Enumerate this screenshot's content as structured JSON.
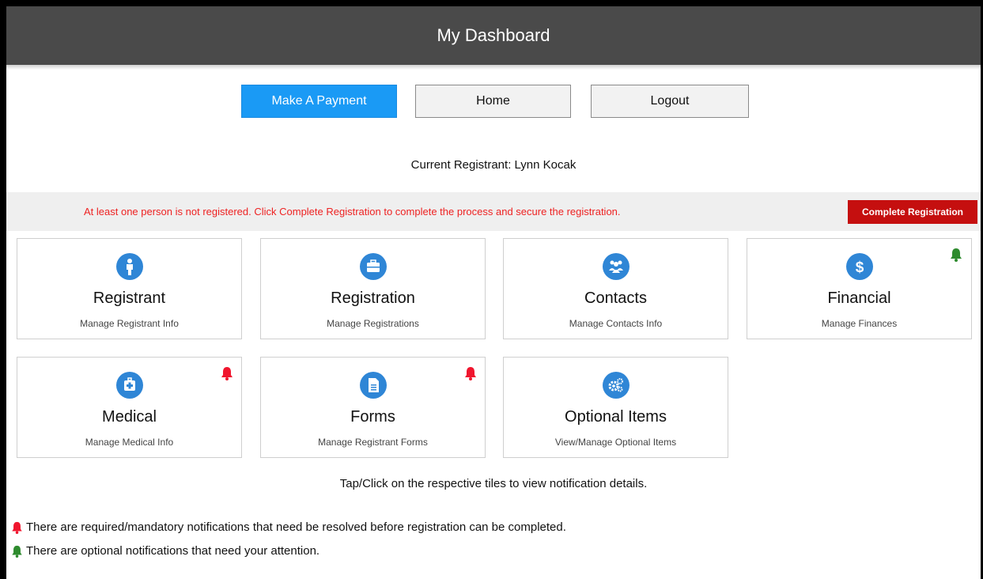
{
  "header": {
    "title": "My Dashboard"
  },
  "nav": {
    "make_payment": "Make A Payment",
    "home": "Home",
    "logout": "Logout"
  },
  "registrant": {
    "text": "Current Registrant: Lynn Kocak"
  },
  "alert": {
    "message": "At least one person is not registered. Click Complete Registration to complete the process and secure the registration.",
    "button": "Complete Registration"
  },
  "tiles": [
    {
      "title": "Registrant",
      "subtitle": "Manage Registrant Info",
      "icon": "person-icon",
      "notification": "none"
    },
    {
      "title": "Registration",
      "subtitle": "Manage Registrations",
      "icon": "briefcase-icon",
      "notification": "none"
    },
    {
      "title": "Contacts",
      "subtitle": "Manage Contacts Info",
      "icon": "group-icon",
      "notification": "none"
    },
    {
      "title": "Financial",
      "subtitle": "Manage Finances",
      "icon": "dollar-icon",
      "notification": "optional"
    },
    {
      "title": "Medical",
      "subtitle": "Manage Medical Info",
      "icon": "medical-kit-icon",
      "notification": "required"
    },
    {
      "title": "Forms",
      "subtitle": "Manage Registrant Forms",
      "icon": "document-icon",
      "notification": "required"
    },
    {
      "title": "Optional Items",
      "subtitle": "View/Manage Optional Items",
      "icon": "gears-icon",
      "notification": "none"
    }
  ],
  "hint": "Tap/Click on the respective tiles to view notification details.",
  "legend": {
    "required": "There are required/mandatory notifications that need be resolved before registration can be completed.",
    "optional": "There are optional notifications that need your attention."
  },
  "colors": {
    "header_bg": "#4a4a4a",
    "primary_button": "#1a9af5",
    "alert_text": "#ee2222",
    "complete_button": "#c50f0f",
    "icon_blue": "#2f86d6",
    "bell_required": "#f0162e",
    "bell_optional": "#2e8b2e"
  }
}
